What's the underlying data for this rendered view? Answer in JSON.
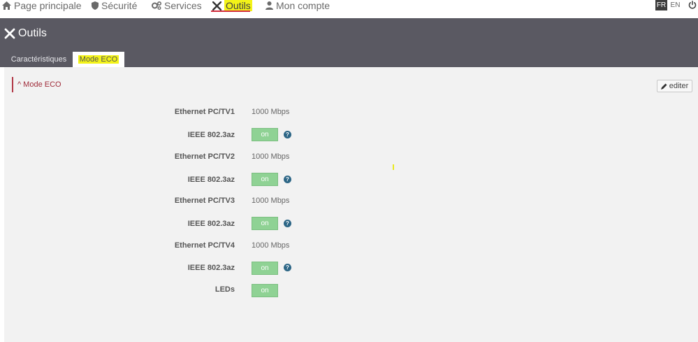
{
  "nav": {
    "items": [
      {
        "label": "Page principale",
        "icon": "home-icon"
      },
      {
        "label": "Sécurité",
        "icon": "shield-icon"
      },
      {
        "label": "Services",
        "icon": "gears-icon"
      },
      {
        "label": "Outils",
        "icon": "tools-icon",
        "active": true
      },
      {
        "label": "Mon compte",
        "icon": "user-icon"
      }
    ],
    "languages": [
      "FR",
      "EN"
    ],
    "selected_language": "FR",
    "highlight_color": "#f3f318",
    "active_underline_color": "#d12b3b"
  },
  "header": {
    "title": "Outils",
    "background": "#5a5962",
    "tabs": [
      {
        "label": "Caractéristiques"
      },
      {
        "label": "Mode ECO",
        "active": true
      }
    ]
  },
  "section": {
    "title": "Mode ECO",
    "edit_label": "editer",
    "rows": [
      {
        "label": "Ethernet PC/TV1",
        "value": "1000 Mbps"
      },
      {
        "label": "IEEE 802.3az",
        "toggle": "on",
        "help": "?"
      },
      {
        "label": "Ethernet PC/TV2",
        "value": "1000 Mbps"
      },
      {
        "label": "IEEE 802.3az",
        "toggle": "on",
        "help": "?"
      },
      {
        "label": "Ethernet PC/TV3",
        "value": "1000 Mbps"
      },
      {
        "label": "IEEE 802.3az",
        "toggle": "on",
        "help": "?"
      },
      {
        "label": "Ethernet PC/TV4",
        "value": "1000 Mbps"
      },
      {
        "label": "IEEE 802.3az",
        "toggle": "on",
        "help": "?"
      },
      {
        "label": "LEDs",
        "toggle": "on"
      }
    ],
    "toggle_color": "#8fd294",
    "help_color": "#2d6686"
  }
}
